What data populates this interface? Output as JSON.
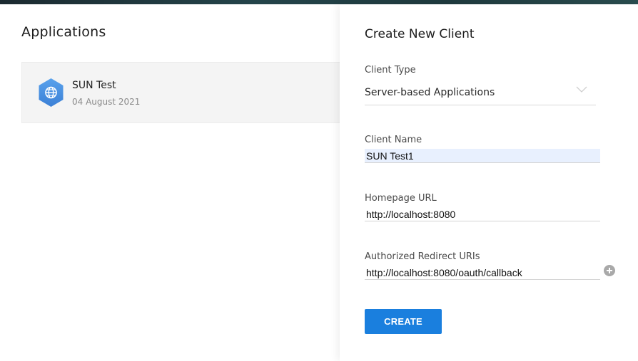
{
  "applications": {
    "title": "Applications",
    "items": [
      {
        "name": "SUN Test",
        "date": "04 August 2021",
        "icon": "globe-icon"
      }
    ]
  },
  "create_client": {
    "title": "Create New Client",
    "client_type": {
      "label": "Client Type",
      "value": "Server-based Applications"
    },
    "client_name": {
      "label": "Client Name",
      "value": "SUN Test1"
    },
    "homepage_url": {
      "label": "Homepage URL",
      "value": "http://localhost:8080"
    },
    "redirect_uris": {
      "label": "Authorized Redirect URIs",
      "value": "http://localhost:8080/oauth/callback",
      "add_icon": "plus-circle-icon"
    },
    "create_button": "CREATE"
  },
  "colors": {
    "accent": "#1a7fde",
    "app_icon": "#4a90e2",
    "autofill_bg": "#e8f0fe"
  }
}
